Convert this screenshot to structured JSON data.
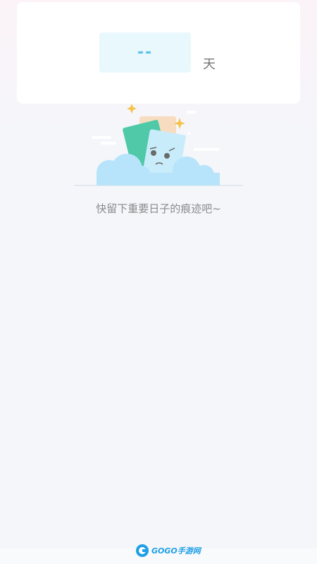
{
  "counter": {
    "value": "--",
    "unit": "天"
  },
  "empty_state": {
    "message": "快留下重要日子的痕迹吧~",
    "illustration": "sad-cards-on-cloud-illustration"
  },
  "watermark": {
    "logo_text": "GOGO手游网",
    "icon": "gogo-logo-icon"
  },
  "colors": {
    "accent": "#5bc3e9",
    "background": "#f4f6fa",
    "card": "#ffffff"
  }
}
